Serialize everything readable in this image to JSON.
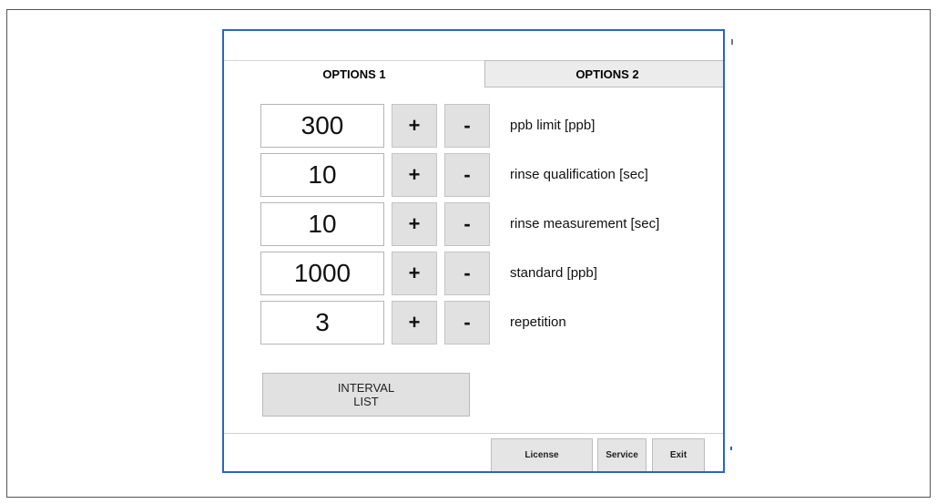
{
  "tabs": {
    "options1": "OPTIONS 1",
    "options2": "OPTIONS 2"
  },
  "settings": [
    {
      "value": "300",
      "plus": "+",
      "minus": "-",
      "label": "ppb limit [ppb]"
    },
    {
      "value": "10",
      "plus": "+",
      "minus": "-",
      "label": "rinse qualification [sec]"
    },
    {
      "value": "10",
      "plus": "+",
      "minus": "-",
      "label": "rinse measurement [sec]"
    },
    {
      "value": "1000",
      "plus": "+",
      "minus": "-",
      "label": "standard [ppb]"
    },
    {
      "value": "3",
      "plus": "+",
      "minus": "-",
      "label": "repetition"
    }
  ],
  "interval_list": {
    "line1": "INTERVAL",
    "line2": "LIST"
  },
  "footer": {
    "license": "License",
    "service": "Service",
    "exit": "Exit"
  },
  "colors": {
    "window_border": "#2a64c8",
    "button_bg": "#e1e1e1"
  }
}
